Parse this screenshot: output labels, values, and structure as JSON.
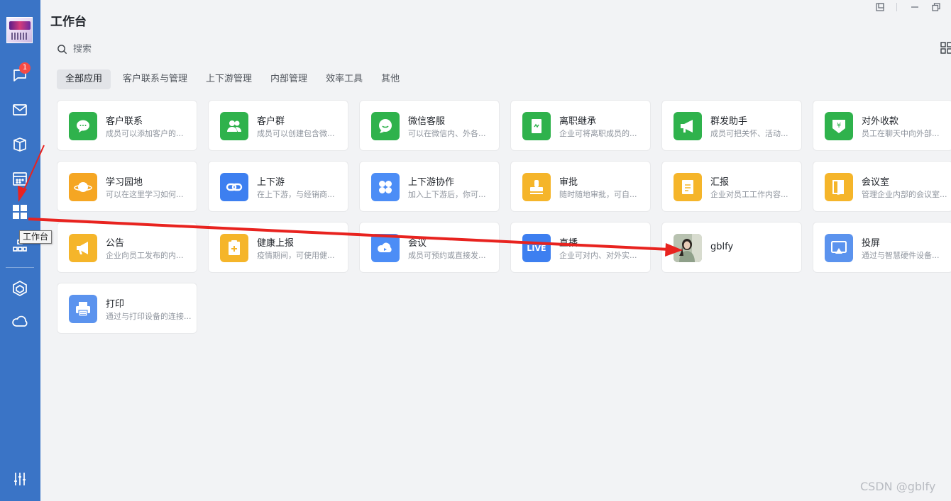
{
  "sidebar": {
    "badge_count": "1",
    "tooltip": "工作台",
    "icons": [
      "chat-icon",
      "mail-icon",
      "docs-icon",
      "calendar-icon",
      "workbench-icon",
      "contacts-icon",
      "apps-icon",
      "cloud-icon",
      "settings-icon"
    ]
  },
  "header": {
    "title": "工作台"
  },
  "search": {
    "placeholder": "搜索"
  },
  "tabs": [
    {
      "label": "全部应用",
      "active": true
    },
    {
      "label": "客户联系与管理"
    },
    {
      "label": "上下游管理"
    },
    {
      "label": "内部管理"
    },
    {
      "label": "效率工具"
    },
    {
      "label": "其他"
    }
  ],
  "apps": [
    {
      "name": "客户联系",
      "desc": "成员可以添加客户的...",
      "color": "#2fb24c",
      "icon": "chat-bubble-icon"
    },
    {
      "name": "客户群",
      "desc": "成员可以创建包含微...",
      "color": "#2fb24c",
      "icon": "group-icon"
    },
    {
      "name": "微信客服",
      "desc": "可以在微信内、外各...",
      "color": "#2fb24c",
      "icon": "wechat-service-icon"
    },
    {
      "name": "离职继承",
      "desc": "企业可将离职成员的...",
      "color": "#2fb24c",
      "icon": "transfer-icon"
    },
    {
      "name": "群发助手",
      "desc": "成员可把关怀、活动...",
      "color": "#2fb24c",
      "icon": "megaphone-icon"
    },
    {
      "name": "对外收款",
      "desc": "员工在聊天中向外部...",
      "color": "#2fb24c",
      "icon": "payment-icon"
    },
    {
      "name": "学习园地",
      "desc": "可以在这里学习如何...",
      "color": "#f5a623",
      "icon": "planet-icon"
    },
    {
      "name": "上下游",
      "desc": "在上下游，与经销商...",
      "color": "#3d7ff0",
      "icon": "link-icon"
    },
    {
      "name": "上下游协作",
      "desc": "加入上下游后，你可...",
      "color": "#4c8df6",
      "icon": "clover-icon"
    },
    {
      "name": "审批",
      "desc": "随时随地审批，可自...",
      "color": "#f5b52a",
      "icon": "stamp-icon"
    },
    {
      "name": "汇报",
      "desc": "企业对员工工作内容...",
      "color": "#f5b52a",
      "icon": "report-icon"
    },
    {
      "name": "会议室",
      "desc": "管理企业内部的会议室...",
      "color": "#f5b52a",
      "icon": "door-icon"
    },
    {
      "name": "公告",
      "desc": "企业向员工发布的内...",
      "color": "#f5b52a",
      "icon": "announce-icon"
    },
    {
      "name": "健康上报",
      "desc": "疫情期间，可使用健...",
      "color": "#f5b52a",
      "icon": "health-icon"
    },
    {
      "name": "会议",
      "desc": "成员可预约或直接发...",
      "color": "#4c8df6",
      "icon": "meeting-icon"
    },
    {
      "name": "直播",
      "desc": "企业可对内、对外实...",
      "color": "#3d7ff0",
      "icon": "live-icon",
      "icon_text": "LIVE"
    },
    {
      "name": "gblfy",
      "desc": "",
      "color": "#8a9a88",
      "icon": "avatar-photo-icon"
    },
    {
      "name": "投屏",
      "desc": "通过与智慧硬件设备...",
      "color": "#5b93ee",
      "icon": "cast-icon"
    },
    {
      "name": "打印",
      "desc": "通过与打印设备的连接...",
      "color": "#5b93ee",
      "icon": "printer-icon"
    }
  ],
  "watermark": "CSDN @gblfy",
  "annotation_color": "#e8231f"
}
